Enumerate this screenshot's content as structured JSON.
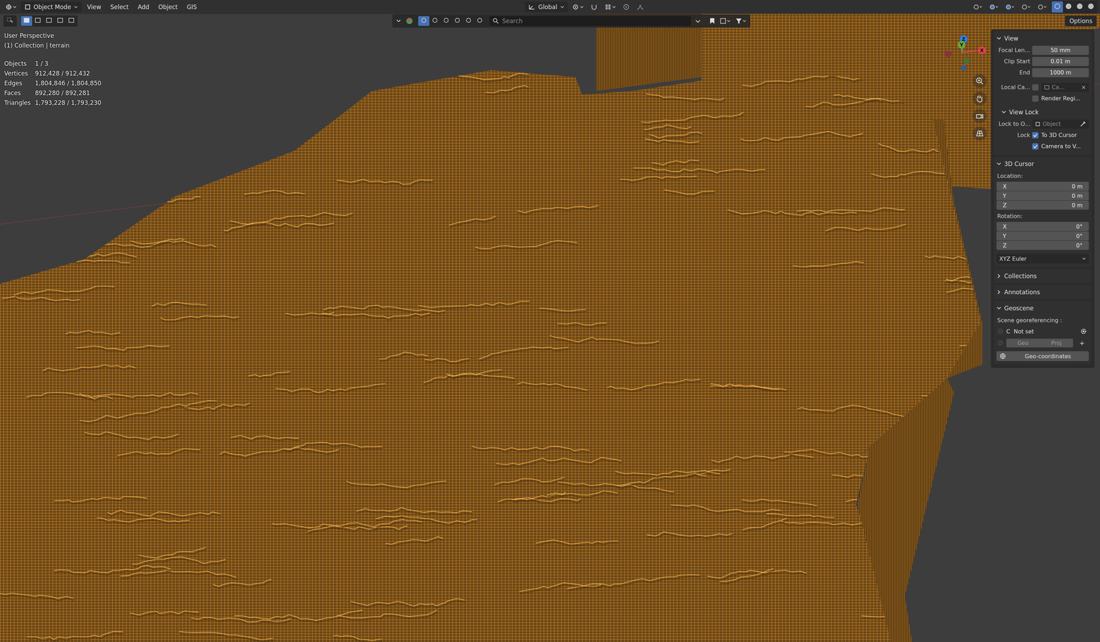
{
  "header": {
    "mode": "Object Mode",
    "menus": [
      "View",
      "Select",
      "Add",
      "Object",
      "GIS"
    ],
    "orientation": "Global"
  },
  "tool_header": {
    "search_placeholder": "Search",
    "options": "Options"
  },
  "overlay": {
    "view_name": "User Perspective",
    "collection": "(1) Collection | terrain",
    "stats": [
      {
        "label": "Objects",
        "value": "1 / 3"
      },
      {
        "label": "Vertices",
        "value": "912,428 / 912,432"
      },
      {
        "label": "Edges",
        "value": "1,804,846 / 1,804,850"
      },
      {
        "label": "Faces",
        "value": "892,280 / 892,281"
      },
      {
        "label": "Triangles",
        "value": "1,793,228 / 1,793,230"
      }
    ]
  },
  "gizmo": {
    "axes": [
      {
        "label": "Z",
        "color": "#2f7fe8"
      },
      {
        "label": "Y",
        "color": "#6ca33a"
      },
      {
        "label": "X",
        "color": "#e0424c"
      }
    ]
  },
  "sidebar": {
    "view": {
      "title": "View",
      "expanded": true,
      "fields": [
        {
          "label": "Focal Len...",
          "value": "50 mm"
        },
        {
          "label": "Clip Start",
          "value": "0.01 m"
        },
        {
          "label": "End",
          "value": "1000 m"
        }
      ],
      "local_camera": {
        "label": "Local Ca...",
        "checked": false,
        "field": "Ca...",
        "clear": "×"
      },
      "render_region": {
        "label": "Render Regi...",
        "checked": false
      },
      "view_lock": {
        "title": "View Lock",
        "expanded": true,
        "lock_to_object": {
          "label": "Lock to O...",
          "placeholder": "Object"
        },
        "lock_label": "Lock",
        "checks": [
          {
            "label": "To 3D Cursor",
            "checked": true
          },
          {
            "label": "Camera to V...",
            "checked": true
          }
        ]
      }
    },
    "cursor": {
      "title": "3D Cursor",
      "expanded": true,
      "location_label": "Location:",
      "location": [
        {
          "axis": "X",
          "value": "0 m"
        },
        {
          "axis": "Y",
          "value": "0 m"
        },
        {
          "axis": "Z",
          "value": "0 m"
        }
      ],
      "rotation_label": "Rotation:",
      "rotation": [
        {
          "axis": "X",
          "value": "0°"
        },
        {
          "axis": "Y",
          "value": "0°"
        },
        {
          "axis": "Z",
          "value": "0°"
        }
      ],
      "rotation_mode": "XYZ Euler"
    },
    "collapsed": [
      {
        "title": "Collections",
        "expanded": false
      },
      {
        "title": "Annotations",
        "expanded": false
      }
    ],
    "geoscene": {
      "title": "Geoscene",
      "expanded": true,
      "label": "Scene georeferencing :",
      "crs_key": "C",
      "crs_value": "Not set",
      "buttons": [
        "Geo",
        "Proj"
      ],
      "add": "+",
      "geo_button": "Geo-coordinates"
    }
  }
}
